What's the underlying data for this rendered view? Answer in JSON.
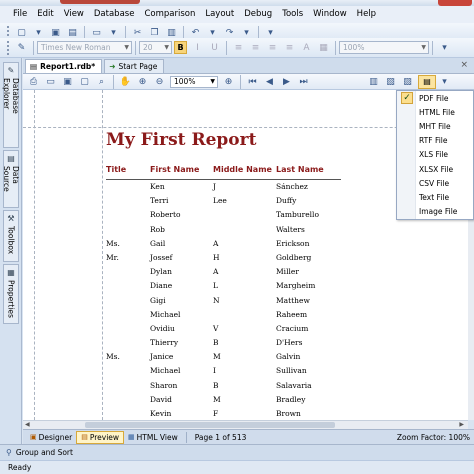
{
  "menu": [
    "File",
    "Edit",
    "View",
    "Database",
    "Comparison",
    "Layout",
    "Debug",
    "Tools",
    "Window",
    "Help"
  ],
  "format_toolbar": {
    "font_name": "Times New Roman",
    "font_size": "20",
    "bold_label": "B",
    "zoom": "100%"
  },
  "sidebar": {
    "tabs": [
      {
        "label": "Database Explorer",
        "icon": "database-icon"
      },
      {
        "label": "Data Source",
        "icon": "datasource-icon"
      },
      {
        "label": "Toolbox",
        "icon": "toolbox-icon"
      },
      {
        "label": "Properties",
        "icon": "properties-icon"
      }
    ]
  },
  "doc_tabs": [
    {
      "label": "Report1.rdb*",
      "active": true
    },
    {
      "label": "Start Page",
      "active": false
    }
  ],
  "preview_toolbar": {
    "zoom": "100%"
  },
  "report": {
    "title": "My First Report",
    "columns": [
      "Title",
      "First Name",
      "Middle Name",
      "Last Name"
    ],
    "rows": [
      [
        "",
        "Ken",
        "J",
        "Sánchez"
      ],
      [
        "",
        "Terri",
        "Lee",
        "Duffy"
      ],
      [
        "",
        "Roberto",
        "",
        "Tamburello"
      ],
      [
        "",
        "Rob",
        "",
        "Walters"
      ],
      [
        "Ms.",
        "Gail",
        "A",
        "Erickson"
      ],
      [
        "Mr.",
        "Jossef",
        "H",
        "Goldberg"
      ],
      [
        "",
        "Dylan",
        "A",
        "Miller"
      ],
      [
        "",
        "Diane",
        "L",
        "Margheim"
      ],
      [
        "",
        "Gigi",
        "N",
        "Matthew"
      ],
      [
        "",
        "Michael",
        "",
        "Raheem"
      ],
      [
        "",
        "Ovidiu",
        "V",
        "Cracium"
      ],
      [
        "",
        "Thierry",
        "B",
        "D'Hers"
      ],
      [
        "Ms.",
        "Janice",
        "M",
        "Galvin"
      ],
      [
        "",
        "Michael",
        "I",
        "Sullivan"
      ],
      [
        "",
        "Sharon",
        "B",
        "Salavaria"
      ],
      [
        "",
        "David",
        "M",
        "Bradley"
      ],
      [
        "",
        "Kevin",
        "F",
        "Brown"
      ]
    ]
  },
  "export_menu": {
    "items": [
      "PDF File",
      "HTML File",
      "MHT File",
      "RTF File",
      "XLS File",
      "XLSX File",
      "CSV File",
      "Text File",
      "Image File"
    ],
    "checked_index": 0
  },
  "bottom_tabs": {
    "designer": "Designer",
    "preview": "Preview",
    "html_view": "HTML View",
    "page_info": "Page 1 of 513",
    "zoom_factor": "Zoom Factor: 100%"
  },
  "group_sort": "Group and Sort",
  "status": "Ready"
}
